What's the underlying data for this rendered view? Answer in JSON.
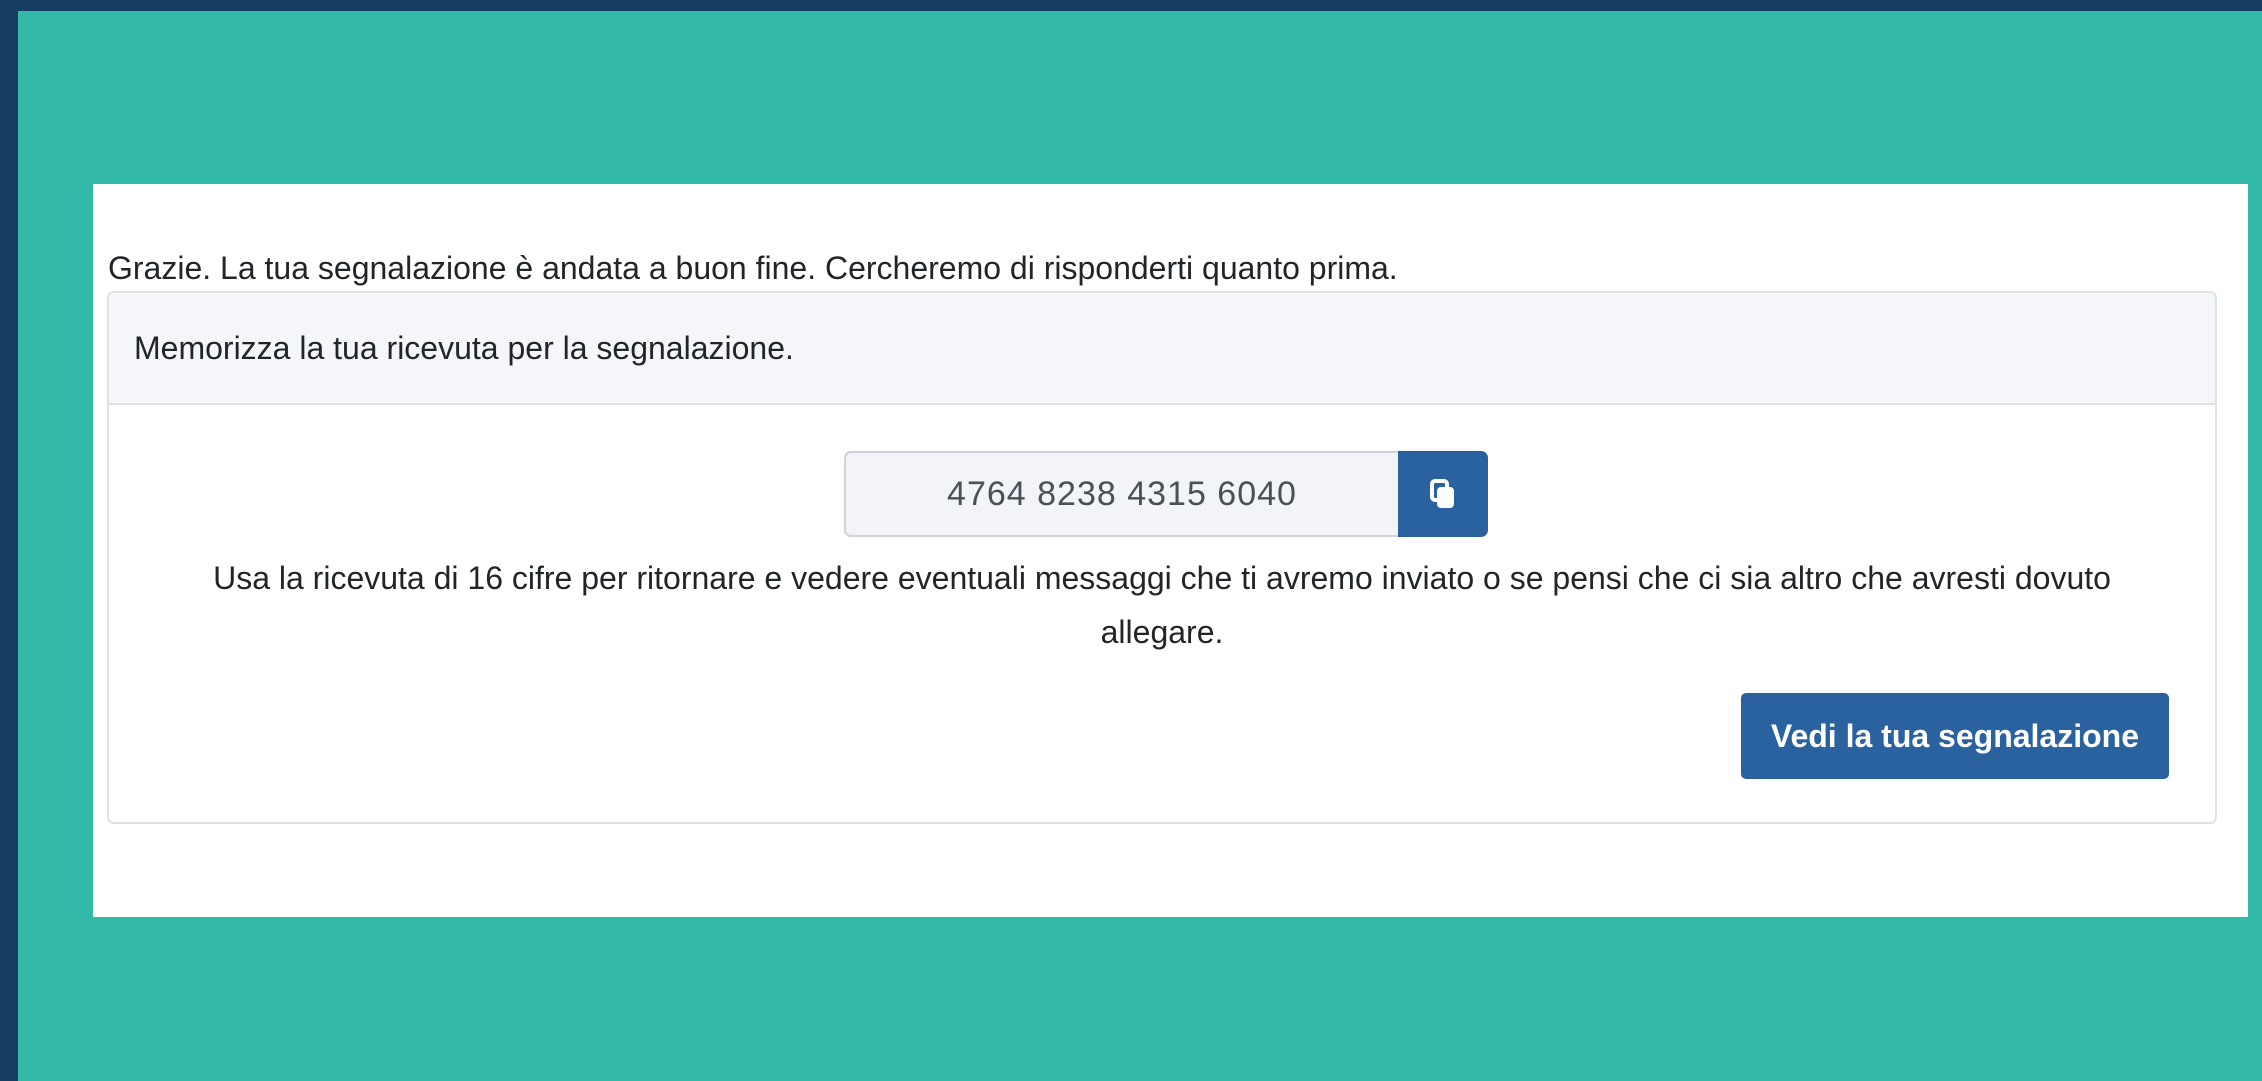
{
  "colors": {
    "frame_background": "#163e63",
    "page_background": "#32b9a7",
    "panel_background": "#ffffff",
    "card_header_background": "#f4f6f9",
    "primary_button": "#2a62a0"
  },
  "confirmation": {
    "message": "Grazie. La tua segnalazione è andata a buon fine. Cercheremo di risponderti quanto prima."
  },
  "receipt_card": {
    "header": "Memorizza la tua ricevuta per la segnalazione.",
    "receipt_number": "4764 8238 4315 6040",
    "copy_icon": "copy-icon",
    "instructions": "Usa la ricevuta di 16 cifre per ritornare e vedere eventuali messaggi che ti avremo inviato o se pensi che ci sia altro che avresti dovuto allegare.",
    "view_button_label": "Vedi la tua segnalazione"
  }
}
